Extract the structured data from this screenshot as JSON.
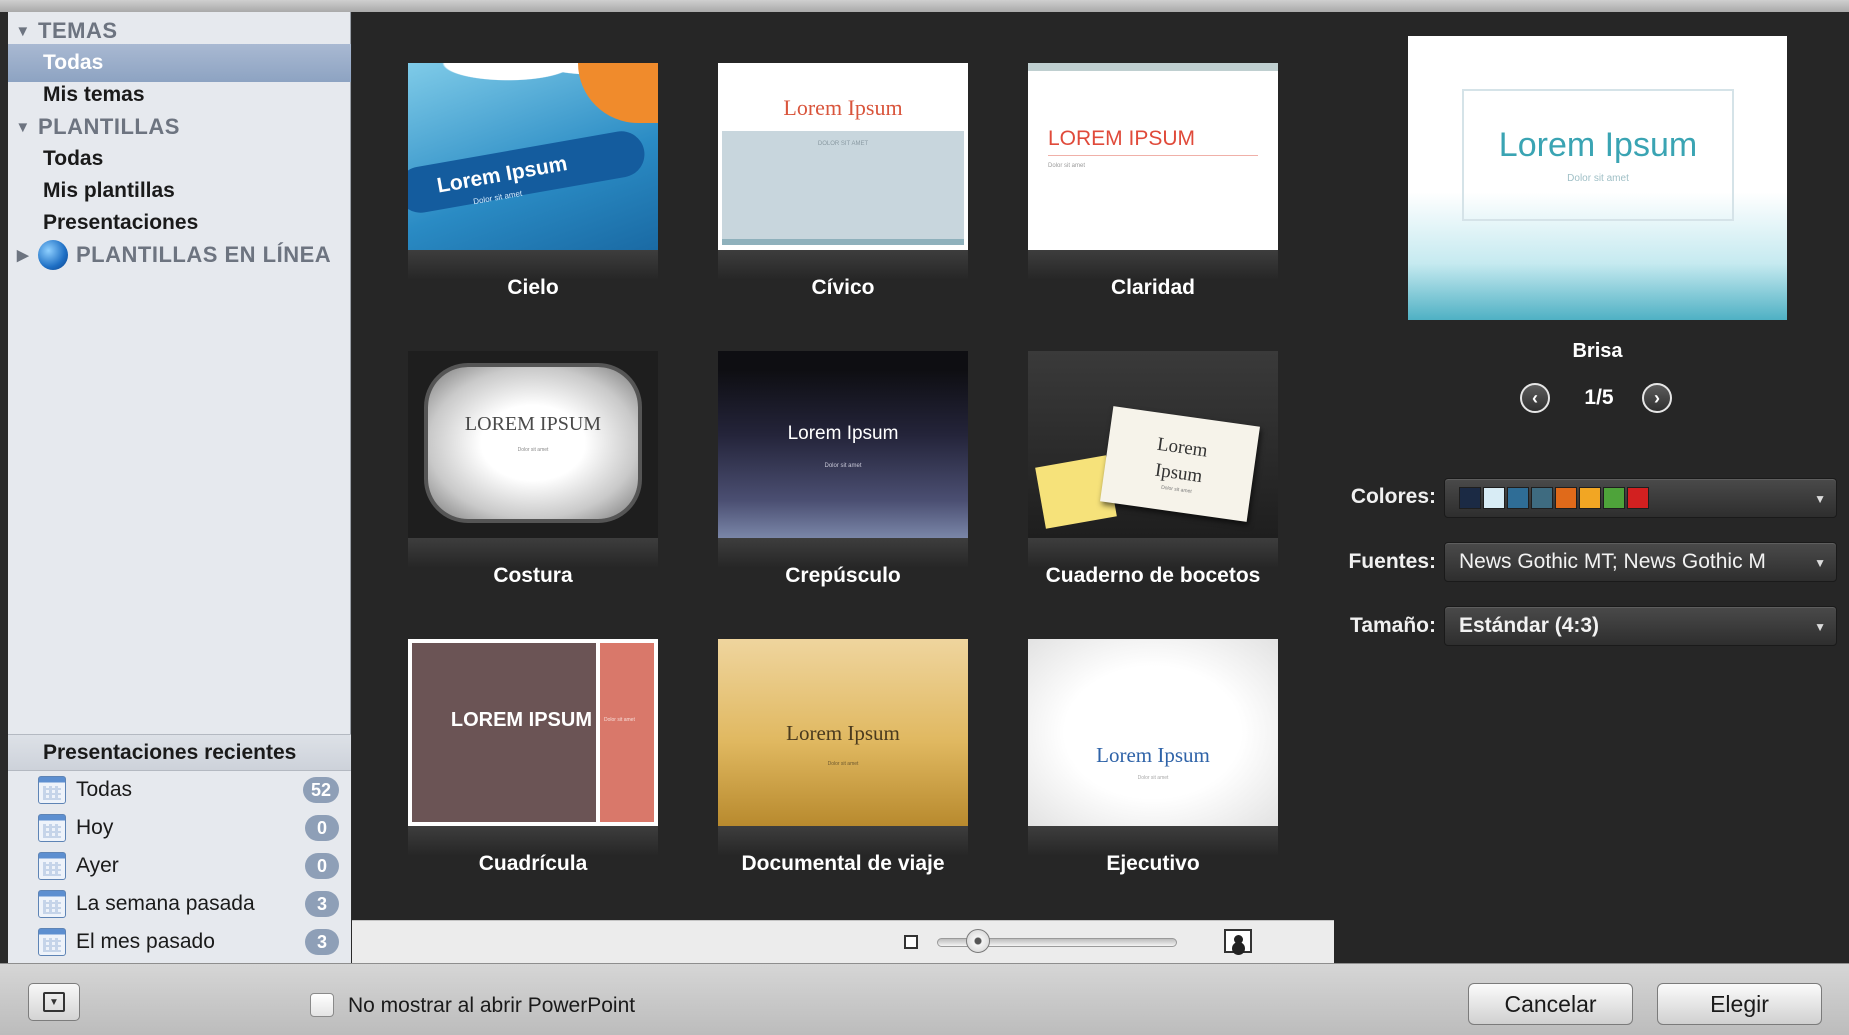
{
  "sidebar": {
    "temas_header": "TEMAS",
    "temas_items": [
      "Todas",
      "Mis temas"
    ],
    "plantillas_header": "PLANTILLAS",
    "plantillas_items": [
      "Todas",
      "Mis plantillas",
      "Presentaciones"
    ],
    "online_header": "PLANTILLAS EN LÍNEA",
    "icons": {
      "expanded": "triangle-down-icon",
      "collapsed": "triangle-right-icon",
      "online": "globe-icon",
      "calendar": "calendar-icon"
    }
  },
  "recent": {
    "header": "Presentaciones recientes",
    "items": [
      {
        "label": "Todas",
        "count": "52"
      },
      {
        "label": "Hoy",
        "count": "0"
      },
      {
        "label": "Ayer",
        "count": "0"
      },
      {
        "label": "La semana pasada",
        "count": "3"
      },
      {
        "label": "El mes pasado",
        "count": "3"
      }
    ]
  },
  "gallery": {
    "themes": [
      {
        "name": "Cielo",
        "thumb_title": "Lorem Ipsum",
        "thumb_sub": "Dolor sit amet"
      },
      {
        "name": "Cívico",
        "thumb_title": "Lorem Ipsum",
        "thumb_sub": "DOLOR SIT AMET"
      },
      {
        "name": "Claridad",
        "thumb_title": "LOREM IPSUM",
        "thumb_sub": "Dolor sit amet"
      },
      {
        "name": "Costura",
        "thumb_title": "LOREM IPSUM",
        "thumb_sub": "Dolor sit amet"
      },
      {
        "name": "Crepúsculo",
        "thumb_title": "Lorem Ipsum",
        "thumb_sub": "Dolor sit amet"
      },
      {
        "name": "Cuaderno de bocetos",
        "thumb_title": "Lorem Ipsum",
        "thumb_sub": "Dolor sit amet"
      },
      {
        "name": "Cuadrícula",
        "thumb_title": "LOREM IPSUM",
        "thumb_sub": "Dolor sit amet"
      },
      {
        "name": "Documental de viaje",
        "thumb_title": "Lorem Ipsum",
        "thumb_sub": "Dolor sit amet"
      },
      {
        "name": "Ejecutivo",
        "thumb_title": "Lorem Ipsum",
        "thumb_sub": "Dolor sit amet"
      }
    ],
    "zoom_icons": {
      "small": "small-thumbnail-icon",
      "large": "large-thumbnail-icon"
    },
    "zoom_level": 0.17
  },
  "preview": {
    "title": "Lorem Ipsum",
    "subtitle": "Dolor sit amet",
    "name": "Brisa",
    "page": "1/5",
    "prev_icon": "chevron-left-icon",
    "next_icon": "chevron-right-icon"
  },
  "properties": {
    "colors_label": "Colores:",
    "colors": [
      "#1b2a44",
      "#d8ecf5",
      "#2f6d96",
      "#3e6b80",
      "#e06a1a",
      "#f2a623",
      "#4ea33a",
      "#d22020"
    ],
    "fonts_label": "Fuentes:",
    "fonts_value": "News Gothic MT; News Gothic M",
    "size_label": "Tamaño:",
    "size_value": "Estándar (4:3)",
    "dropdown_icon": "chevron-down-icon"
  },
  "footer": {
    "collapse_icon": "sidebar-toggle-icon",
    "checkbox_label": "No mostrar al abrir PowerPoint",
    "checkbox_checked": false,
    "cancel": "Cancelar",
    "choose": "Elegir"
  }
}
